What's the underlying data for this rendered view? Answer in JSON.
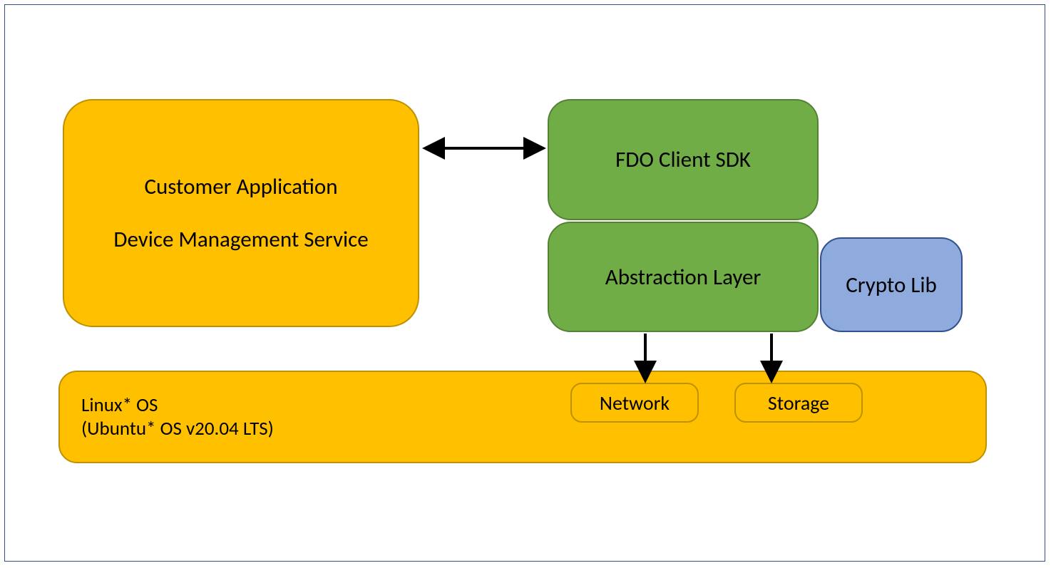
{
  "customer_app": {
    "line1": "Customer Application",
    "line2": "Device Management Service"
  },
  "fdo_sdk": {
    "label": "FDO Client SDK"
  },
  "abstraction": {
    "label": "Abstraction Layer"
  },
  "crypto_lib": {
    "label": "Crypto Lib"
  },
  "linux_os": {
    "line1": "Linux* OS",
    "line2": "(Ubuntu* OS v20.04 LTS)"
  },
  "network": {
    "label": "Network"
  },
  "storage": {
    "label": "Storage"
  },
  "colors": {
    "orange_fill": "#FFC000",
    "orange_border": "#BF9000",
    "green_fill": "#70AD47",
    "green_border": "#548235",
    "blue_fill": "#8FAADC",
    "blue_border": "#2F528F",
    "frame_border": "#2F528F"
  }
}
